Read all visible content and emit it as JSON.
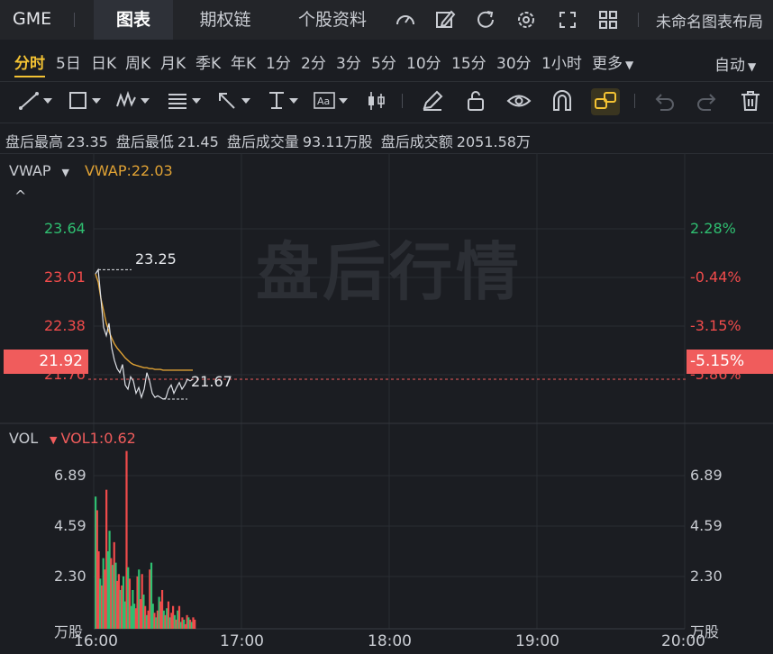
{
  "header": {
    "ticker": "GME",
    "tabs": [
      {
        "label": "图表",
        "active": true
      },
      {
        "label": "期权链",
        "active": false
      },
      {
        "label": "个股资料",
        "active": false
      }
    ],
    "icons": [
      "gauge-icon",
      "edit-icon",
      "refresh-icon",
      "settings-icon",
      "fullscreen-icon",
      "grid-icon"
    ],
    "layout_name": "未命名图表布局"
  },
  "periods": {
    "items": [
      "分时",
      "5日",
      "日K",
      "周K",
      "月K",
      "季K",
      "年K",
      "1分",
      "2分",
      "3分",
      "5分",
      "10分",
      "15分",
      "30分",
      "1小时",
      "更多"
    ],
    "active": "分时",
    "mode": "自动"
  },
  "toolbar": {
    "tools": [
      "trendline-tool-icon",
      "rectangle-tool-icon",
      "pattern-tool-icon",
      "fib-tool-icon",
      "arrow-tool-icon",
      "measure-tool-icon",
      "text-tool-icon",
      "candle-tool-icon",
      "pencil-icon",
      "lock-icon",
      "eye-icon",
      "magnet-icon",
      "link-icon",
      "undo-icon",
      "redo-icon",
      "trash-icon"
    ],
    "active_tool": "link-icon"
  },
  "stats": {
    "high_label": "盘后最高",
    "high_value": "23.35",
    "low_label": "盘后最低",
    "low_value": "21.45",
    "vol_label": "盘后成交量",
    "vol_value": "93.11万股",
    "amt_label": "盘后成交额",
    "amt_value": "2051.58万"
  },
  "price_panel": {
    "indicator_name": "VWAP",
    "indicator_value": "VWAP:22.03",
    "left_labels": [
      "23.64",
      "23.01",
      "22.38",
      "21.76"
    ],
    "right_labels": [
      "2.28%",
      "-0.44%",
      "-3.15%",
      "-5.86%"
    ],
    "current_price": "21.92",
    "current_pct": "-5.15%",
    "max_marker": "23.25",
    "min_marker": "21.67",
    "watermark": "盘后行情"
  },
  "volume_panel": {
    "indicator_name": "VOL",
    "indicator_value": "VOL1:0.62",
    "labels": [
      "6.89",
      "4.59",
      "2.30"
    ],
    "unit": "万股"
  },
  "time_axis": [
    "16:00",
    "17:00",
    "18:00",
    "19:00",
    "20:00"
  ],
  "colors": {
    "up": "#f04b4b",
    "down": "#2fbf71",
    "accent": "#f3c233",
    "vwap": "#e0a234"
  },
  "chart_data": {
    "type": "line",
    "price_series": [
      23.2,
      23.25,
      22.9,
      22.55,
      22.45,
      22.6,
      22.3,
      22.15,
      22.05,
      22.0,
      22.1,
      21.85,
      21.8,
      21.95,
      21.9,
      21.75,
      21.82,
      21.7,
      21.8,
      22.0,
      21.9,
      21.75,
      21.7,
      21.72,
      21.7,
      21.68,
      21.69,
      21.8,
      21.85,
      21.75,
      21.82,
      21.88,
      21.8,
      21.85,
      21.92,
      21.9,
      21.92
    ],
    "vwap_series": [
      23.2,
      23.1,
      22.9,
      22.75,
      22.6,
      22.5,
      22.42,
      22.35,
      22.3,
      22.26,
      22.22,
      22.18,
      22.15,
      22.12,
      22.1,
      22.09,
      22.08,
      22.07,
      22.06,
      22.06,
      22.05,
      22.05,
      22.04,
      22.04,
      22.04,
      22.03,
      22.03,
      22.03,
      22.03,
      22.03,
      22.03,
      22.03,
      22.03,
      22.03,
      22.03,
      22.03,
      22.03
    ],
    "volume": [
      5.8,
      5.2,
      3.4,
      2.2,
      1.9,
      3.1,
      2.6,
      6.1,
      3.4,
      4.3,
      3.1,
      2.8,
      3.8,
      2.9,
      2.1,
      2.4,
      1.7,
      1.9,
      2.3,
      1.2,
      7.8,
      2.7,
      2.2,
      1.0,
      1.7,
      1.1,
      0.9,
      2.3,
      2.6,
      1.3,
      2.4,
      1.5,
      1.0,
      0.6,
      0.8,
      2.6,
      2.9,
      1.1,
      0.7,
      0.5,
      0.8,
      1.4,
      1.2,
      1.7,
      0.8,
      0.6,
      0.9,
      1.2,
      0.5,
      0.7,
      1.0,
      0.6,
      0.4,
      0.8,
      1.0,
      0.3,
      0.5,
      0.4,
      0.2,
      0.6,
      0.5,
      0.4,
      0.3,
      0.5,
      0.4
    ],
    "volume_up": [
      false,
      true,
      true,
      false,
      true,
      false,
      true,
      true,
      false,
      false,
      true,
      false,
      true,
      false,
      true,
      true,
      false,
      true,
      false,
      false,
      true,
      false,
      true,
      false,
      false,
      false,
      true,
      true,
      false,
      true,
      true,
      false,
      true,
      false,
      true,
      true,
      false,
      false,
      true,
      false,
      true,
      false,
      true,
      true,
      false,
      true,
      false,
      true,
      false,
      true,
      true,
      false,
      true,
      false,
      true,
      false,
      true,
      false,
      true,
      true,
      false,
      true,
      false,
      true,
      true
    ],
    "ylim": [
      21.45,
      23.9
    ],
    "vol_ylim": [
      0,
      8.3
    ]
  }
}
